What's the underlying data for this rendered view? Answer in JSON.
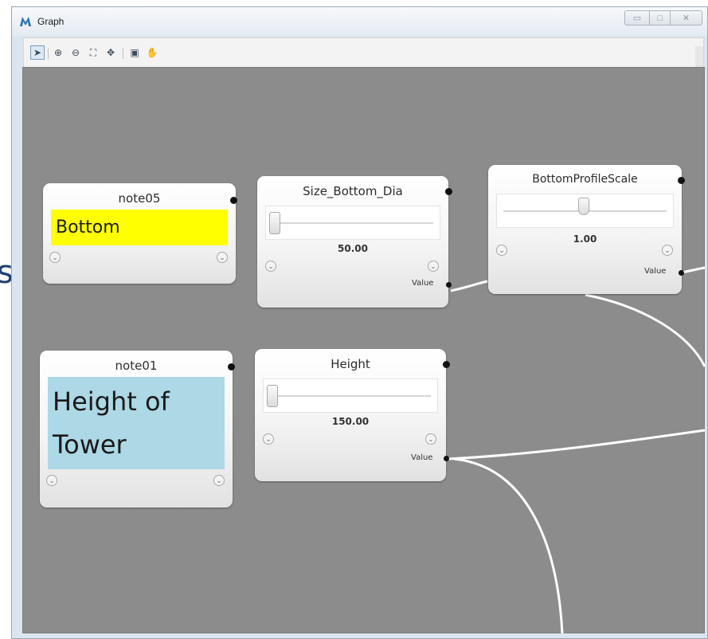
{
  "window": {
    "title": "Graph",
    "controls": [
      "minimize",
      "maximize",
      "close"
    ]
  },
  "toolbar": {
    "tools": [
      {
        "name": "select-tool-icon",
        "glyph": "➤"
      },
      {
        "name": "zoom-in-icon",
        "glyph": "⊕"
      },
      {
        "name": "zoom-out-icon",
        "glyph": "⊖"
      },
      {
        "name": "fit-view-icon",
        "glyph": "⛶"
      },
      {
        "name": "pan-arrows-icon",
        "glyph": "✥"
      },
      {
        "name": "snapshot-icon",
        "glyph": "▣"
      },
      {
        "name": "hand-icon",
        "glyph": "✋"
      }
    ]
  },
  "edge_glyph": "s",
  "nodes": {
    "note05": {
      "title": "note05",
      "text": "Bottom",
      "bg": "#ffff00"
    },
    "note01": {
      "title": "note01",
      "text": "Height of Tower",
      "bg": "#add8e6"
    },
    "size_bottom_dia": {
      "title": "Size_Bottom_Dia",
      "value": "50.00",
      "port_label": "Value",
      "slider_position": 0.0
    },
    "height": {
      "title": "Height",
      "value": "150.00",
      "port_label": "Value",
      "slider_position": 0.0
    },
    "bottom_profile_scale": {
      "title": "BottomProfileScale",
      "value": "1.00",
      "port_label": "Value",
      "slider_position": 0.5
    }
  },
  "colors": {
    "canvas": "#8c8c8c",
    "wire": "#ffffff",
    "note_yellow": "#ffff00",
    "note_blue": "#add8e6"
  }
}
